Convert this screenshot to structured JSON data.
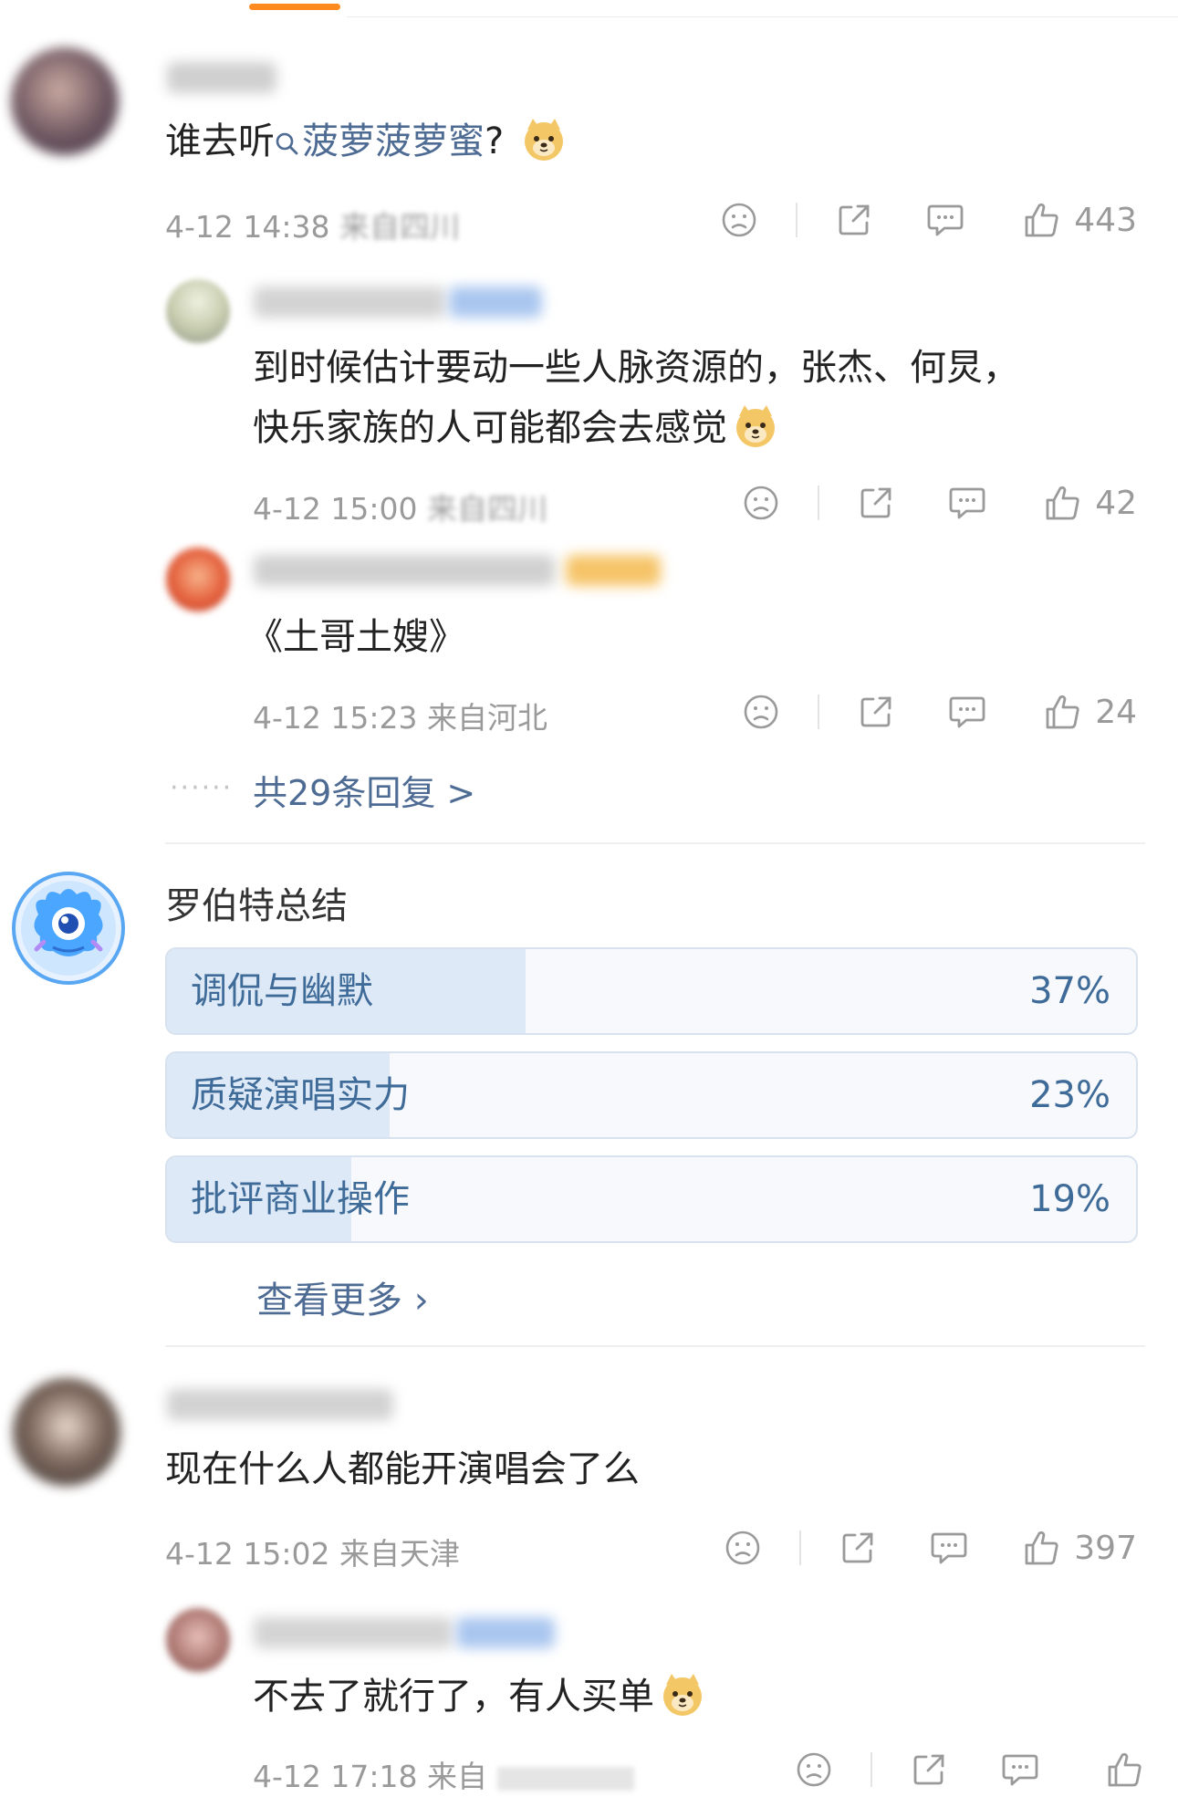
{
  "colors": {
    "accent": "#ff8a1f",
    "link": "#4e6b94",
    "meta": "#9a9a9a",
    "poll_fill": "#dde9f6",
    "poll_text": "#3f6b99"
  },
  "comment1": {
    "text_pre": "谁去听",
    "search_link": "菠萝菠萝蜜",
    "text_post": "?",
    "emoji": "doge-emoji",
    "time": "4-12 14:38",
    "location": "来自四川",
    "likes": "443"
  },
  "replies1": [
    {
      "text_line1": "到时候估计要动一些人脉资源的，张杰、何炅，",
      "text_line2": "快乐家族的人可能都会去感觉",
      "emoji": "doge-emoji",
      "time": "4-12 15:00",
      "location": "来自四川",
      "likes": "42"
    },
    {
      "text": "《土哥土嫂》",
      "time": "4-12 15:23",
      "location": "来自河北",
      "likes": "24"
    }
  ],
  "more_replies": "共29条回复 >",
  "summary": {
    "title": "罗伯特总结",
    "options": [
      {
        "label": "调侃与幽默",
        "percent": "37%",
        "value": 0.37
      },
      {
        "label": "质疑演唱实力",
        "percent": "23%",
        "value": 0.23
      },
      {
        "label": "批评商业操作",
        "percent": "19%",
        "value": 0.19
      }
    ],
    "see_more": "查看更多 ›"
  },
  "comment2": {
    "text": "现在什么人都能开演唱会了么",
    "time": "4-12 15:02",
    "location": "来自天津",
    "likes": "397"
  },
  "replies2": [
    {
      "text": "不去了就行了，有人买单",
      "emoji": "doge-emoji",
      "time": "4-12 17:18",
      "location": "来自"
    }
  ]
}
